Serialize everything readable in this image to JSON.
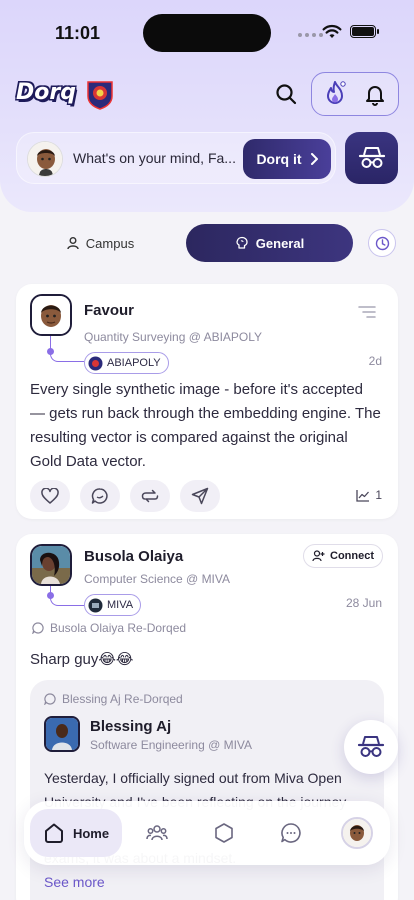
{
  "status_bar": {
    "time": "11:01"
  },
  "header": {
    "logo_text": "Dorq"
  },
  "composer": {
    "prompt": "What's on your mind, Fa...",
    "dorq_button_label": "Dorq it"
  },
  "tabs": {
    "campus_label": "Campus",
    "general_label": "General",
    "active": "General"
  },
  "posts": [
    {
      "author": "Favour",
      "dept": "Quantity Surveying @ ABIAPOLY",
      "school": "ABIAPOLY",
      "time": "2d",
      "lines": [
        "Every single synthetic image - before it's accepted",
        "— gets run back through the embedding engine. The",
        "resulting vector is compared against the original",
        "Gold Data vector."
      ],
      "views": "1"
    },
    {
      "author": "Busola Olaiya",
      "dept": "Computer Science @ MIVA",
      "school": "MIVA",
      "time": "28 Jun",
      "connect_label": "Connect",
      "redorq_note": "Busola Olaiya Re-Dorqed",
      "text": "Sharp guy😂😂",
      "quoted": {
        "redorq_note": "Blessing Aj Re-Dorqed",
        "author": "Blessing Aj",
        "dept": "Software Engineering @ MIVA",
        "lines": [
          "Yesterday, I officially signed out from Miva Open",
          "University and I've been reflecting on the journey",
          "exams, it was about a mindset."
        ],
        "see_more": "See more"
      }
    }
  ],
  "bottom_nav": {
    "home_label": "Home",
    "active": "Home"
  },
  "colors": {
    "accent": "#2c275f",
    "accent_light": "#8a6ee6",
    "header_bg": "#dcd6fb",
    "page_bg": "#f4f3f8",
    "meta_text": "#8d8a9e"
  }
}
